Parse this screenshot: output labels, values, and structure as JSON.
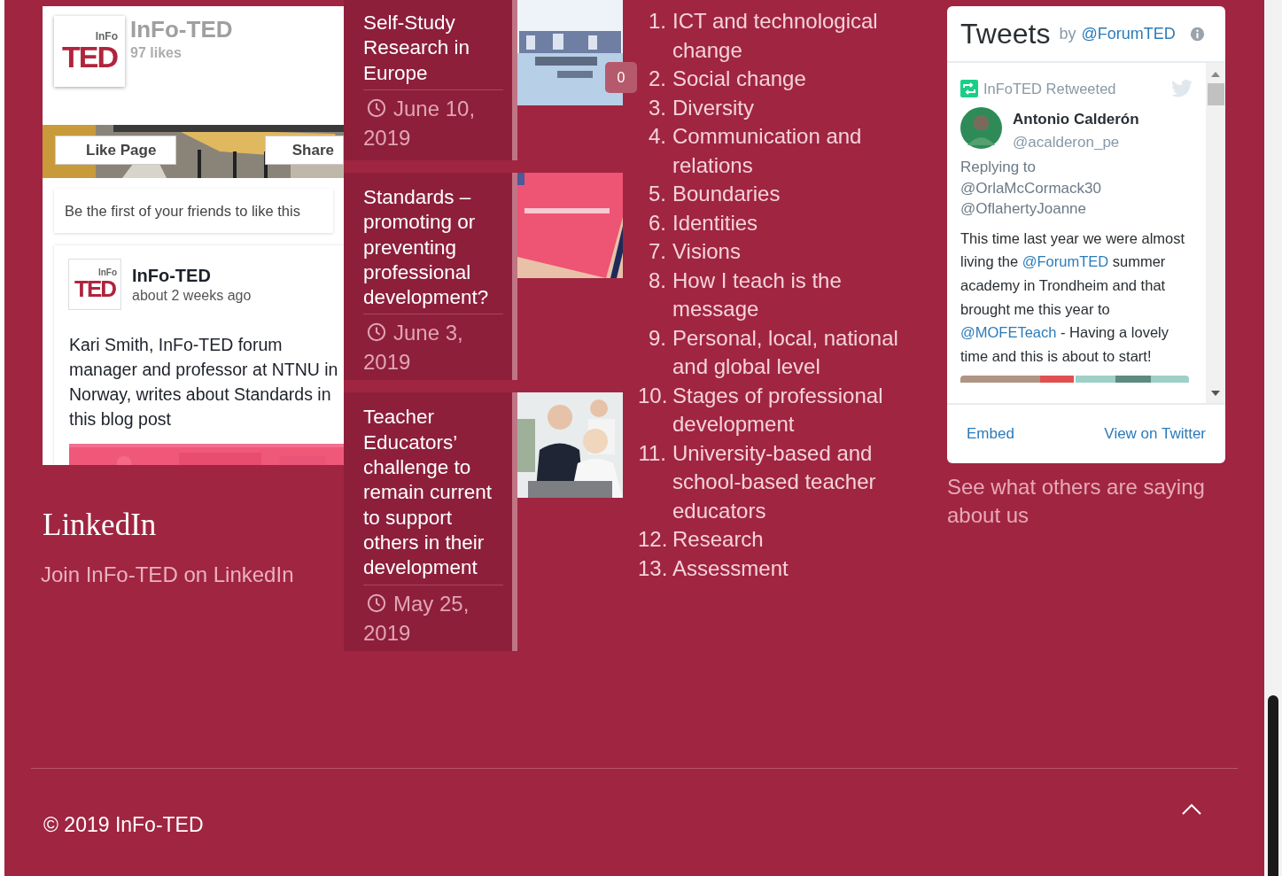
{
  "facebook_widget": {
    "page_logo": {
      "upper": "InFo",
      "lower": "TED"
    },
    "page_name": "InFo-TED",
    "likes": "97 likes",
    "like_button": "Like Page",
    "share_button": "Share",
    "friends_note": "Be the first of your friends to like this",
    "post": {
      "logo": {
        "upper": "InFo",
        "lower": "TED"
      },
      "author": "InFo-TED",
      "time": "about 2 weeks ago",
      "text": "Kari Smith, InFo-TED forum manager and professor at NTNU in Norway, writes about Standards in this blog post"
    }
  },
  "linkedin": {
    "heading": "LinkedIn",
    "link": "Join InFo-TED on LinkedIn"
  },
  "posts": [
    {
      "title": "Self-Study Research in Europe",
      "date": "June 10, 2019",
      "comments": "0"
    },
    {
      "title": "Standards – promoting or preventing professional development?",
      "date": "June 3, 2019"
    },
    {
      "title": "Teacher Educators’ challenge to remain current to support others in their development",
      "date": "May 25, 2019"
    }
  ],
  "topics": [
    {
      "number": "1.",
      "label": "ICT and technological change"
    },
    {
      "number": "2.",
      "label": "Social change"
    },
    {
      "number": "3.",
      "label": "Diversity"
    },
    {
      "number": "4.",
      "label": "Communication and relations"
    },
    {
      "number": "5.",
      "label": "Boundaries"
    },
    {
      "number": "6.",
      "label": "Identities"
    },
    {
      "number": "7.",
      "label": "Visions"
    },
    {
      "number": "8.",
      "label": "How I teach is the message"
    },
    {
      "number": "9.",
      "label": "Personal, local, national and global level"
    },
    {
      "number": "10.",
      "label": "Stages of professional development"
    },
    {
      "number": "11.",
      "label": "University-based and school-based teacher educators"
    },
    {
      "number": "12.",
      "label": "Research"
    },
    {
      "number": "13.",
      "label": "Assessment"
    }
  ],
  "twitter": {
    "title": "Tweets",
    "by": "by",
    "handle": "@ForumTED",
    "retweeted_by": "InFoTED Retweeted",
    "author_name": "Antonio Calderón",
    "author_handle": "@acalderon_pe",
    "replying_to": "Replying to",
    "reply_handles": [
      "@OrlaMcCormack30",
      "@OflahertyJoanne"
    ],
    "tweet": [
      {
        "kind": "text",
        "text": "This time last year we were almost living the "
      },
      {
        "kind": "mention",
        "text": "@ForumTED"
      },
      {
        "kind": "text",
        "text": " summer academy in Trondheim and that brought me this year to "
      },
      {
        "kind": "mention",
        "text": "@MOFETeach"
      },
      {
        "kind": "text",
        "text": " - Having a lovely time and this is about to start!"
      }
    ],
    "embed": "Embed",
    "view_on_twitter": "View on Twitter"
  },
  "tagline": "See what others are saying about us",
  "footer": {
    "copyright": "© 2019 InFo-TED"
  }
}
